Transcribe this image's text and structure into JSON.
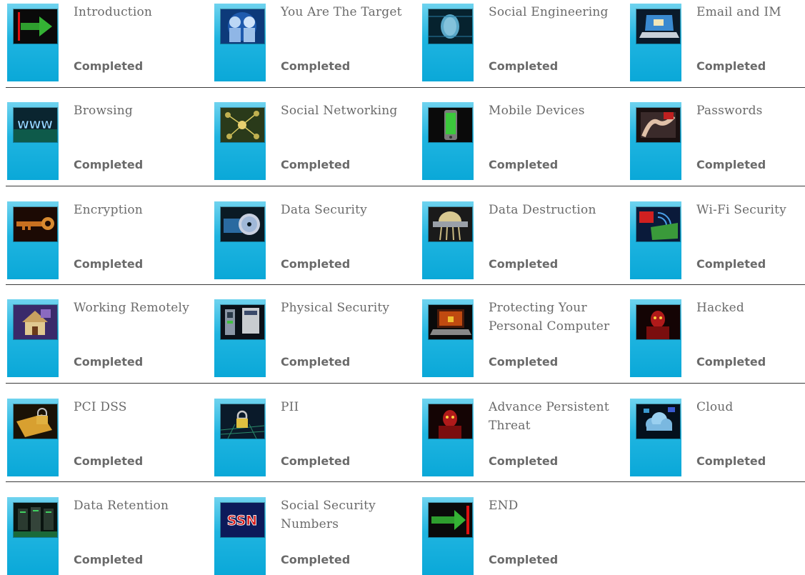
{
  "modules": [
    {
      "title": "Introduction",
      "status": "Completed",
      "icon": "green-arrow-icon"
    },
    {
      "title": "You Are The Target",
      "status": "Completed",
      "icon": "two-heads-icon"
    },
    {
      "title": "Social Engineering",
      "status": "Completed",
      "icon": "digital-face-icon"
    },
    {
      "title": "Email and IM",
      "status": "Completed",
      "icon": "laptop-email-icon"
    },
    {
      "title": "Browsing",
      "status": "Completed",
      "icon": "www-icon"
    },
    {
      "title": "Social Networking",
      "status": "Completed",
      "icon": "network-nodes-icon"
    },
    {
      "title": "Mobile Devices",
      "status": "Completed",
      "icon": "smartphone-icon"
    },
    {
      "title": "Passwords",
      "status": "Completed",
      "icon": "password-fingers-icon"
    },
    {
      "title": "Encryption",
      "status": "Completed",
      "icon": "key-icon"
    },
    {
      "title": "Data Security",
      "status": "Completed",
      "icon": "disc-icon"
    },
    {
      "title": "Data Destruction",
      "status": "Completed",
      "icon": "shredder-icon"
    },
    {
      "title": "Wi-Fi Security",
      "status": "Completed",
      "icon": "wifi-waves-icon"
    },
    {
      "title": "Working Remotely",
      "status": "Completed",
      "icon": "house-icon"
    },
    {
      "title": "Physical Security",
      "status": "Completed",
      "icon": "badge-reader-icon"
    },
    {
      "title": "Protecting Your Personal Computer",
      "status": "Completed",
      "icon": "laptop-lock-icon"
    },
    {
      "title": "Hacked",
      "status": "Completed",
      "icon": "red-hacker-icon"
    },
    {
      "title": "PCI DSS",
      "status": "Completed",
      "icon": "credit-card-lock-icon"
    },
    {
      "title": "PII",
      "status": "Completed",
      "icon": "padlock-circuit-icon"
    },
    {
      "title": "Advance Persistent Threat",
      "status": "Completed",
      "icon": "red-hacker-icon"
    },
    {
      "title": "Cloud",
      "status": "Completed",
      "icon": "cloud-icon"
    },
    {
      "title": "Data Retention",
      "status": "Completed",
      "icon": "server-racks-icon"
    },
    {
      "title": "Social Security Numbers",
      "status": "Completed",
      "icon": "ssn-text-icon"
    },
    {
      "title": "END",
      "status": "Completed",
      "icon": "green-arrow-end-icon"
    }
  ],
  "thumbnail_text": {
    "www": "WWW",
    "ssn": "SSN"
  },
  "colors": {
    "accent_bar": "#1fb4e0",
    "text": "#6a6a6a",
    "separator": "#3a3a3a"
  }
}
